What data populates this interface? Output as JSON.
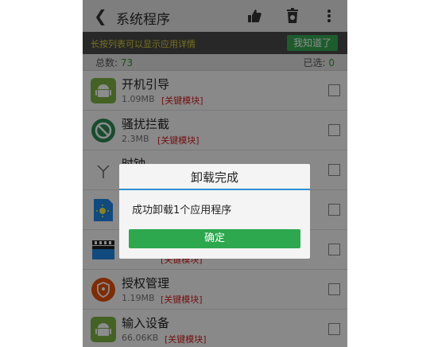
{
  "header": {
    "title": "系统程序"
  },
  "tip": {
    "text": "长按列表可以显示应用详情",
    "button": "我知道了"
  },
  "stats": {
    "total_label": "总数: ",
    "total_value": "73",
    "selected_label": "已选: ",
    "selected_value": "0"
  },
  "apps": [
    {
      "name": "开机引导",
      "size": "1.09MB",
      "tag": "[关键模块]",
      "icon": "android-icon"
    },
    {
      "name": "骚扰拦截",
      "size": "2.3MB",
      "tag": "[关键模块]",
      "icon": "block-icon"
    },
    {
      "name": "时钟",
      "size": "",
      "tag": "",
      "icon": "clock-icon"
    },
    {
      "name": "",
      "size": "",
      "tag": "",
      "icon": "weather-icon"
    },
    {
      "name": "",
      "size": "",
      "tag": "[关键模块]",
      "icon": "video-icon"
    },
    {
      "name": "授权管理",
      "size": "1.19MB",
      "tag": "[关键模块]",
      "icon": "shield-icon"
    },
    {
      "name": "输入设备",
      "size": "66.06KB",
      "tag": "[关键模块]",
      "icon": "android-icon"
    }
  ],
  "dialog": {
    "title": "卸载完成",
    "message": "成功卸载1个应用程序",
    "button": "确定"
  },
  "colors": {
    "accent_green": "#2ea84f",
    "tag_red": "#d32020",
    "title_line_blue": "#2f8fd0"
  }
}
